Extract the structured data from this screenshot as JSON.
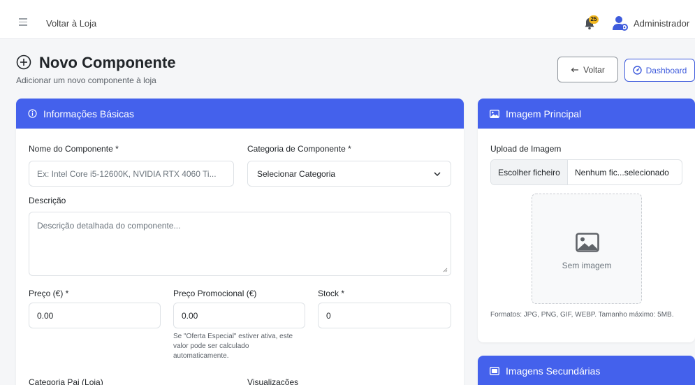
{
  "topbar": {
    "back_to_store": "Voltar à Loja",
    "notification_count": "25",
    "user_name": "Administrador"
  },
  "header": {
    "title": "Novo Componente",
    "subtitle": "Adicionar um novo componente à loja",
    "back_button": "Voltar",
    "dashboard_button": "Dashboard"
  },
  "basic_info": {
    "title": "Informações Básicas",
    "name_label": "Nome do Componente *",
    "name_placeholder": "Ex: Intel Core i5-12600K, NVIDIA RTX 4060 Ti...",
    "category_label": "Categoria de Componente *",
    "category_value": "Selecionar Categoria",
    "description_label": "Descrição",
    "description_placeholder": "Descrição detalhada do componente...",
    "price_label": "Preço (€) *",
    "price_value": "0.00",
    "promo_label": "Preço Promocional (€)",
    "promo_value": "0.00",
    "promo_help": "Se \"Oferta Especial\" estiver ativa, este valor pode ser calculado automaticamente.",
    "stock_label": "Stock *",
    "stock_value": "0",
    "parent_category_label": "Categoria Pai (Loja)",
    "views_label": "Visualizações"
  },
  "main_image": {
    "title": "Imagem Principal",
    "upload_label": "Upload de Imagem",
    "choose_file": "Escolher ficheiro",
    "no_file": "Nenhum fic...selecionado",
    "no_image": "Sem imagem",
    "formats_help": "Formatos: JPG, PNG, GIF, WEBP. Tamanho máximo: 5MB."
  },
  "secondary_images": {
    "title": "Imagens Secundárias"
  },
  "colors": {
    "accent": "#4461ec",
    "badge": "#f2b71f"
  },
  "icons": [
    "menu-icon",
    "bell-icon",
    "user-gear-icon",
    "plus-circle-icon",
    "arrow-left-icon",
    "dashboard-icon",
    "info-icon",
    "image-icon",
    "chevron-down-icon",
    "images-icon"
  ]
}
